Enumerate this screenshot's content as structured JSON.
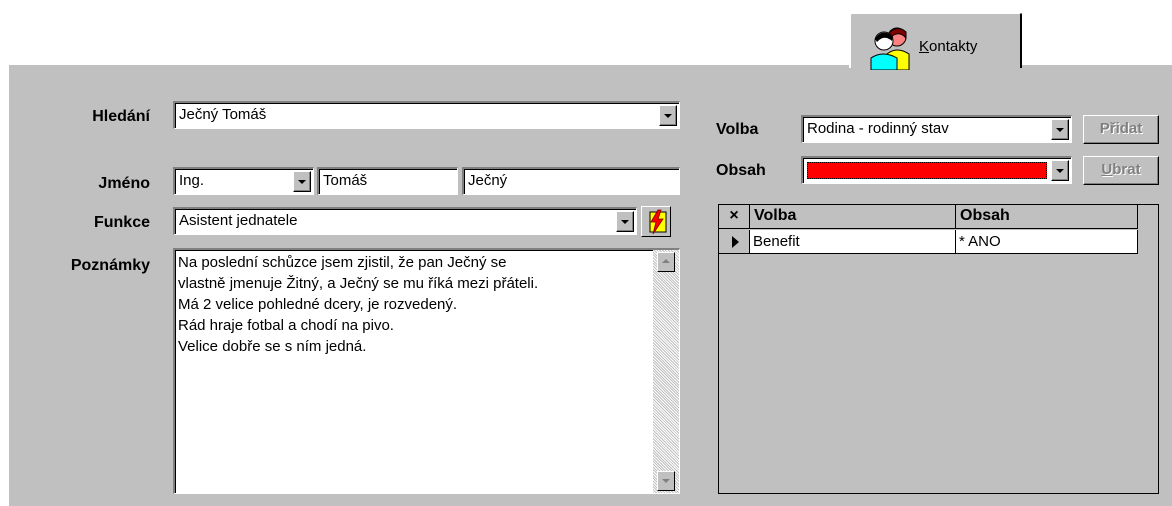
{
  "tab": {
    "label": "Kontakty",
    "icon": "people-icon"
  },
  "form": {
    "search": {
      "label": "Hledání",
      "value": "Ječný Tomáš"
    },
    "name": {
      "label": "Jméno",
      "title": "Ing.",
      "first": "Tomáš",
      "last": "Ječný"
    },
    "function": {
      "label": "Funkce",
      "value": "Asistent jednatele"
    },
    "notes": {
      "label": "Poznámky",
      "lines": [
        "Na poslední schůzce jsem zjistil, že pan Ječný se",
        "vlastně jmenuje Žitný, a Ječný se mu říká mezi přáteli.",
        "Má 2 velice pohledné dcery, je rozvedený.",
        "Rád hraje fotbal a chodí na pivo.",
        "Velice dobře se s ním jedná."
      ]
    }
  },
  "side": {
    "volba": {
      "label": "Volba",
      "value": "Rodina - rodinný stav"
    },
    "obsah": {
      "label": "Obsah",
      "value": "",
      "color": "#ff0000"
    },
    "add_button": "Přidat",
    "remove_button": "Ubrat",
    "grid": {
      "corner": "×",
      "columns": [
        "Volba",
        "Obsah"
      ],
      "rows": [
        {
          "volba": "Benefit",
          "obsah": "* ANO"
        }
      ]
    }
  },
  "colors": {
    "face": "#c0c0c0",
    "accent_red": "#ff0000"
  }
}
